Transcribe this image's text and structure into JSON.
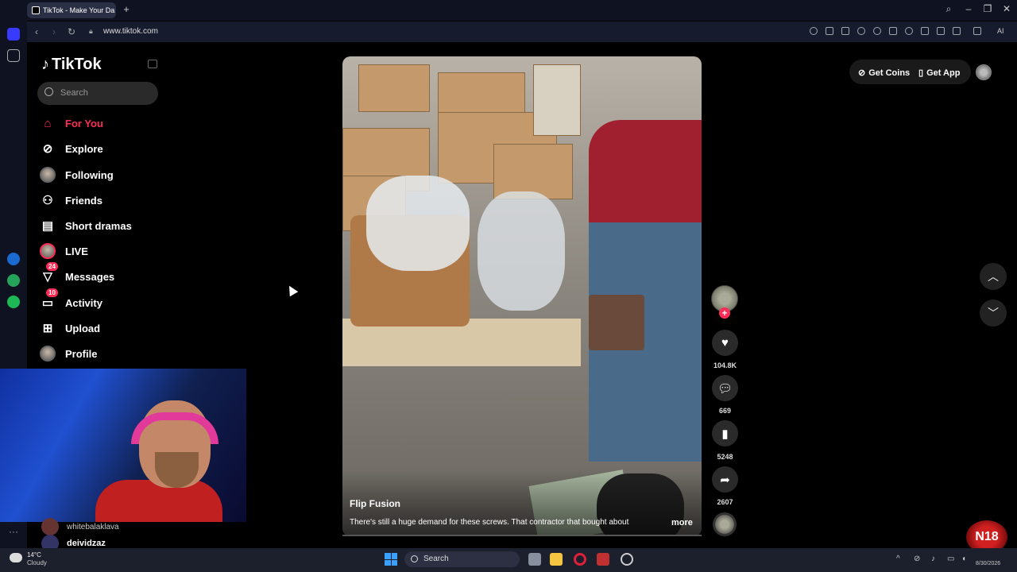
{
  "browser": {
    "tab_title": "TikTok - Make Your Da",
    "url": "www.tiktok.com",
    "new_tab": "+"
  },
  "tiktok": {
    "logo_text": "TikTok",
    "search_placeholder": "Search",
    "nav": [
      {
        "label": "For You",
        "icon": "home-icon"
      },
      {
        "label": "Explore",
        "icon": "compass-icon"
      },
      {
        "label": "Following",
        "icon": "following-avatar-icon"
      },
      {
        "label": "Friends",
        "icon": "friends-icon"
      },
      {
        "label": "Short dramas",
        "icon": "film-icon"
      },
      {
        "label": "LIVE",
        "icon": "live-avatar-icon"
      },
      {
        "label": "Messages",
        "icon": "send-icon",
        "badge": "24"
      },
      {
        "label": "Activity",
        "icon": "inbox-icon",
        "badge": "10"
      },
      {
        "label": "Upload",
        "icon": "plus-square-icon"
      },
      {
        "label": "Profile",
        "icon": "profile-avatar-icon"
      }
    ],
    "following_accounts": [
      {
        "name": "whitebalaklava"
      },
      {
        "name": "deividzaz"
      }
    ],
    "top_actions": {
      "get_coins": "Get Coins",
      "get_app": "Get App"
    },
    "video": {
      "author": "Flip Fusion",
      "description": "There's still a huge demand for these screws.  That contractor that bought about",
      "more": "more",
      "likes": "104.8K",
      "comments": "669",
      "saves": "5248",
      "shares": "2607"
    }
  },
  "taskbar": {
    "weather_temp": "14°C",
    "weather_condition": "Cloudy",
    "search_label": "Search",
    "date": "8/30/2026"
  },
  "overlay": {
    "badge": "N18"
  },
  "colors": {
    "accent": "#fe2c55",
    "background": "#000000",
    "chrome": "#0f1220"
  }
}
